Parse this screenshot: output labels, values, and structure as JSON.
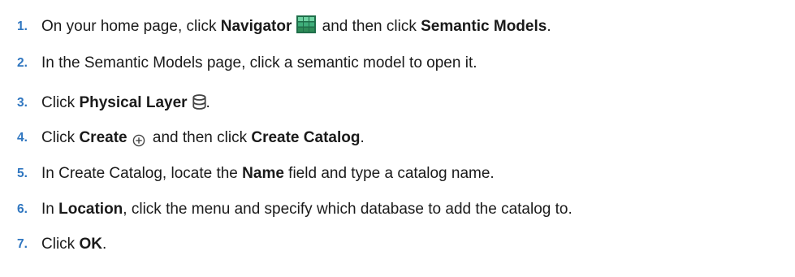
{
  "steps": [
    {
      "number": "1.",
      "parts": {
        "a": "On your home page, click ",
        "b": "Navigator",
        "c": " and then click ",
        "d": "Semantic Models",
        "e": "."
      }
    },
    {
      "number": "2.",
      "parts": {
        "a": "In the Semantic Models page, click a semantic model to open it."
      }
    },
    {
      "number": "3.",
      "parts": {
        "a": "Click ",
        "b": "Physical Layer",
        "c": "."
      }
    },
    {
      "number": "4.",
      "parts": {
        "a": "Click ",
        "b": "Create",
        "c": " and then click ",
        "d": "Create Catalog",
        "e": "."
      }
    },
    {
      "number": "5.",
      "parts": {
        "a": "In Create Catalog, locate the ",
        "b": "Name",
        "c": " field and type a catalog name."
      }
    },
    {
      "number": "6.",
      "parts": {
        "a": "In ",
        "b": "Location",
        "c": ", click the menu and specify which database to add the catalog to."
      }
    },
    {
      "number": "7.",
      "parts": {
        "a": "Click ",
        "b": "OK",
        "c": "."
      }
    }
  ],
  "icons": {
    "navigator": "navigator-grid-icon",
    "physical_layer": "database-icon",
    "create": "plus-circle-icon"
  },
  "colors": {
    "step_number": "#2f76c0",
    "navigator_icon": "#2e8b57",
    "text": "#1a1a1a"
  }
}
